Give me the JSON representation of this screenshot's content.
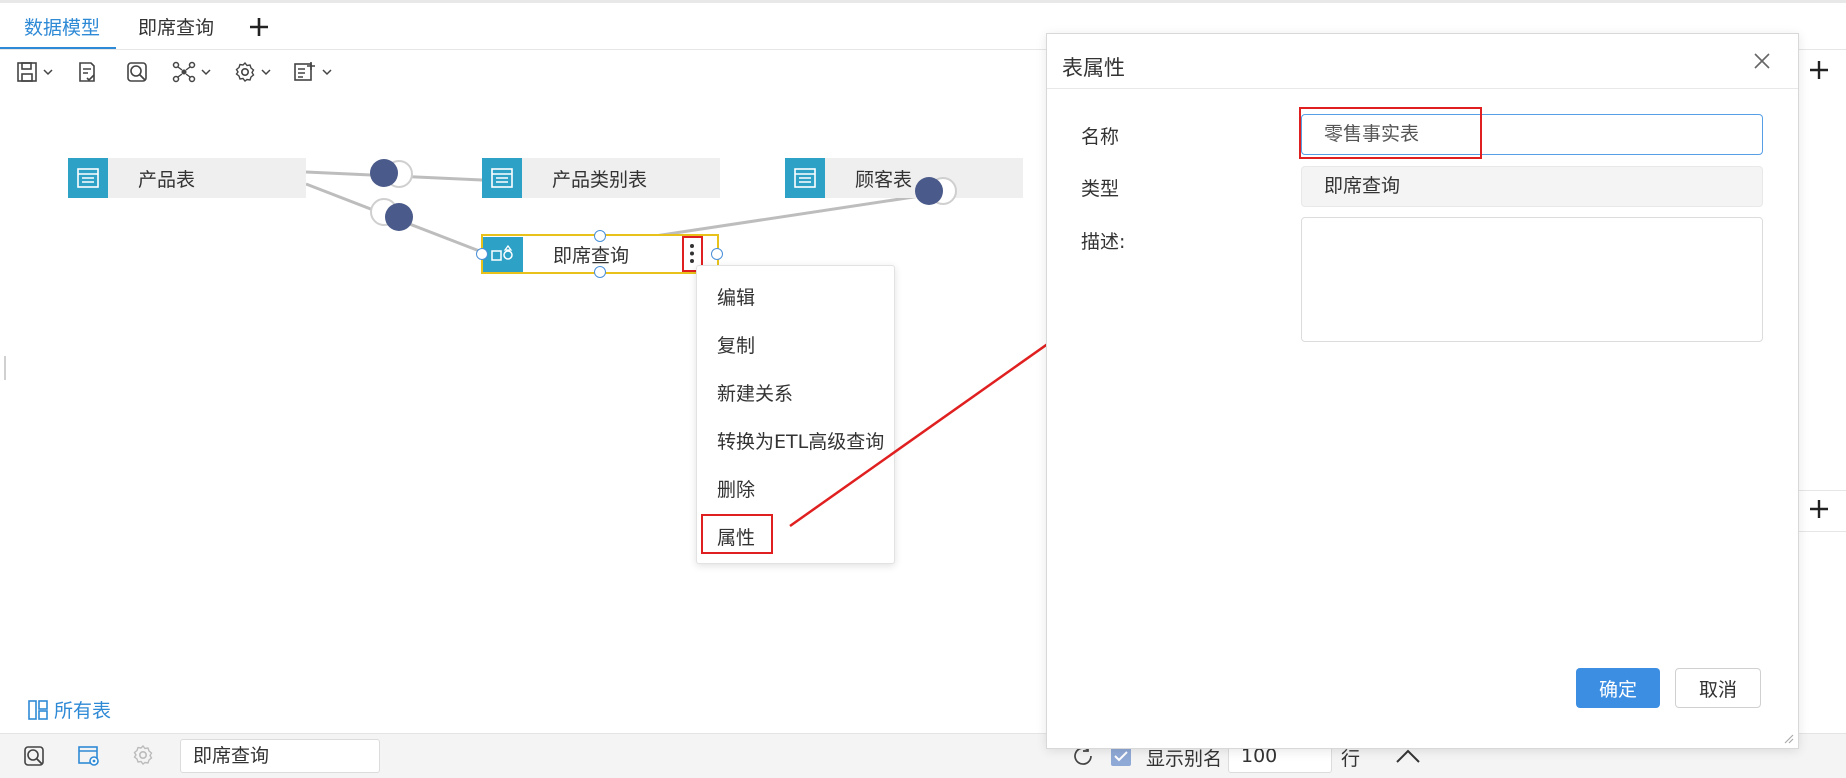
{
  "tabs": [
    {
      "label": "数据模型",
      "active": true
    },
    {
      "label": "即席查询",
      "active": false
    }
  ],
  "add_tab_icon": "plus-icon",
  "toolbar": {
    "icons": [
      "save-icon",
      "check-doc-icon",
      "search-icon",
      "graph-icon",
      "gear-icon",
      "export-icon"
    ]
  },
  "canvas": {
    "nodes": [
      {
        "label": "产品表",
        "icon": "table-icon"
      },
      {
        "label": "产品类别表",
        "icon": "table-icon"
      },
      {
        "label": "顾客表",
        "icon": "table-icon"
      },
      {
        "label": "即席查询",
        "icon": "query-icon",
        "selected": true
      }
    ],
    "all_tables_link": "所有表"
  },
  "context_menu": {
    "items": [
      "编辑",
      "复制",
      "新建关系",
      "转换为ETL高级查询",
      "删除",
      "属性"
    ],
    "highlighted": "属性"
  },
  "dialog": {
    "title": "表属性",
    "fields": {
      "name_label": "名称",
      "name_value": "零售事实表",
      "type_label": "类型",
      "type_value": "即席查询",
      "desc_label": "描述:",
      "desc_value": ""
    },
    "ok_label": "确定",
    "cancel_label": "取消"
  },
  "bottom_bar": {
    "query_input_value": "即席查询",
    "show_alias_label": "显示别名",
    "show_alias_checked": true,
    "row_count": "100",
    "row_unit": "行"
  },
  "colors": {
    "accent": "#2f8ad6",
    "node_icon": "#2da1c6",
    "highlight_red": "#e02020",
    "selected_border": "#e8c21a",
    "primary_button": "#3c8ee3",
    "relation_dot": "#4a5a8a"
  }
}
